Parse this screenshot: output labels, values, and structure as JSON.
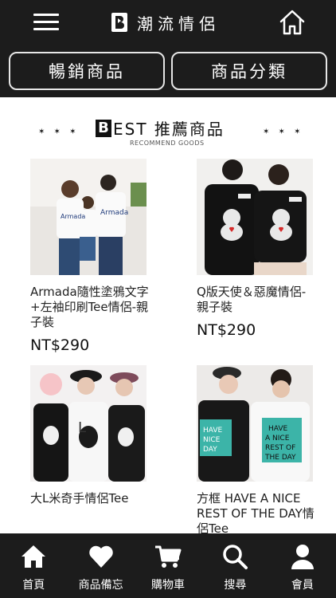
{
  "header": {
    "brand_letter": "B",
    "brand_name": "潮流情侶",
    "menu_icon": "hamburger-menu-icon",
    "home_icon": "home-icon",
    "tabs": [
      {
        "label": "暢銷商品"
      },
      {
        "label": "商品分類"
      }
    ]
  },
  "section": {
    "stars": "✶ ✶ ✶",
    "title_letter": "B",
    "title": "EST 推薦商品",
    "subtitle": "RECOMMEND GOODS"
  },
  "products": [
    {
      "name": "Armada隨性塗鴉文字+左袖印刷Tee情侶-親子裝",
      "price": "NT$290"
    },
    {
      "name": "Q版天使＆惡魔情侶-親子裝",
      "price": "NT$290"
    },
    {
      "name": "大L米奇手情侶Tee",
      "price": ""
    },
    {
      "name": "方框 HAVE A NICE REST OF THE DAY情侶Tee",
      "price": ""
    }
  ],
  "nav": [
    {
      "label": "首頁",
      "icon": "home-icon"
    },
    {
      "label": "商品備忘",
      "icon": "heart-icon"
    },
    {
      "label": "購物車",
      "icon": "cart-icon"
    },
    {
      "label": "搜尋",
      "icon": "search-icon"
    },
    {
      "label": "會員",
      "icon": "user-icon"
    }
  ],
  "colors": {
    "bar": "#1c1c1c",
    "white": "#ffffff"
  }
}
